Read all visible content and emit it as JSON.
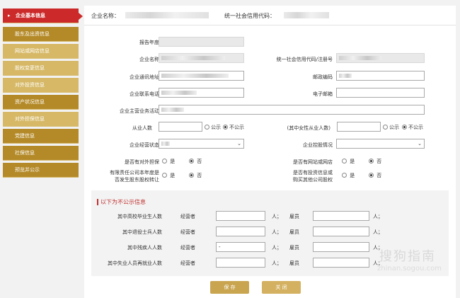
{
  "sidebar": {
    "items": [
      {
        "label": "企业基本信息"
      },
      {
        "label": "股东及出资信息"
      },
      {
        "label": "网站或网店信息"
      },
      {
        "label": "股权变更信息"
      },
      {
        "label": "对外投资信息"
      },
      {
        "label": "资产状况信息"
      },
      {
        "label": "对外担保信息"
      },
      {
        "label": "党建信息"
      },
      {
        "label": "社保信息"
      },
      {
        "label": "预览并公示"
      }
    ]
  },
  "header": {
    "name_label": "企业名称：",
    "code_label": "统一社会信用代码："
  },
  "form": {
    "report_year": "报告年度",
    "company_name": "企业名称",
    "credit_code": "统一社会信用代码/注册号",
    "address": "企业通讯地址",
    "postcode": "邮政编码",
    "phone": "企业联系电话",
    "email": "电子邮箱",
    "business": "企业主营业务活动",
    "employees": "从业人数",
    "female_employees": "(其中女性从业人数)",
    "public_label": "公示",
    "nonpublic_label": "不公示",
    "status": "企业经营状态",
    "holding": "企业控股情况",
    "guarantee": "是否有对外担保",
    "has_site": "是否有网站或网店",
    "equity_transfer_l1": "有限责任公司本年度是",
    "equity_transfer_l2": "否发生股东股权转让",
    "investment_l1": "是否有投资信息或",
    "investment_l2": "购买其他公司股权",
    "yes": "是",
    "no": "否"
  },
  "nonpublic": {
    "title": "以下为不公示信息",
    "rows": [
      {
        "label": "其中高校毕业生人数"
      },
      {
        "label": "其中退役士兵人数"
      },
      {
        "label": "其中残疾人人数"
      },
      {
        "label": "其中失业人员再就业人数"
      }
    ],
    "operator": "经营者",
    "employee": "雇员",
    "unit": "人；",
    "dash_value": "-"
  },
  "buttons": {
    "save": "保 存",
    "close": "关 闭"
  },
  "watermark": {
    "line1": "搜狗指南",
    "line2": "zhinan.sogou.com"
  },
  "colors": {
    "active": "#cc2a2a",
    "gold": "#c6a23f",
    "button": "#c9a550"
  }
}
